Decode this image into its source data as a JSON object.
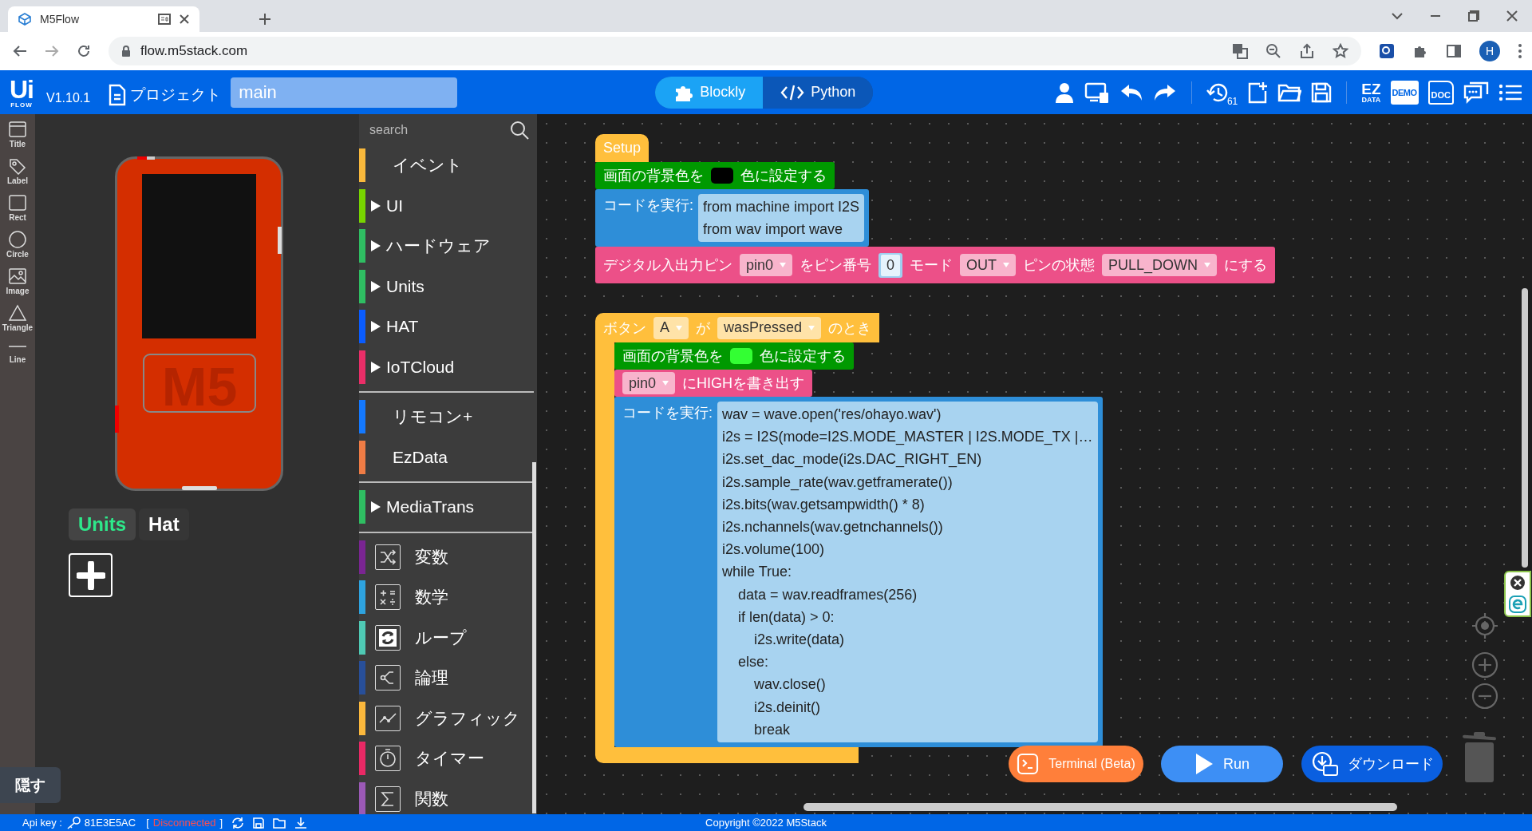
{
  "browser": {
    "tab_title": "M5Flow",
    "url": "flow.m5stack.com",
    "profile_initial": "H"
  },
  "header": {
    "logo": "Ui",
    "logo_sub": "FLOW",
    "version": "V1.10.1",
    "project_label": "プロジェクト",
    "file_name": "main",
    "modes": [
      {
        "label": "Blockly",
        "selected": true
      },
      {
        "label": "Python",
        "selected": false
      }
    ],
    "history_count": "61",
    "ez": "EZ",
    "ez_sub": "DATA",
    "demo": "DEMO",
    "doc": "DOC"
  },
  "tools": [
    "Title",
    "Label",
    "Rect",
    "Circle",
    "Image",
    "Triangle",
    "Line"
  ],
  "device": {
    "logo": "M5",
    "tabs": [
      {
        "label": "Units",
        "selected": true
      },
      {
        "label": "Hat",
        "selected": false
      }
    ]
  },
  "hide_button": "隠す",
  "palette": {
    "placeholder": "search",
    "groups": [
      {
        "items": [
          {
            "label": "イベント",
            "kind": "plain",
            "color": "#f9b93c"
          },
          {
            "label": "UI",
            "kind": "category",
            "color": "#78d400"
          },
          {
            "label": "ハードウェア",
            "kind": "category",
            "color": "#2fbe62"
          },
          {
            "label": "Units",
            "kind": "category",
            "color": "#2fbe62"
          },
          {
            "label": "HAT",
            "kind": "category",
            "color": "#0a5cff"
          },
          {
            "label": "IoTCloud",
            "kind": "category",
            "color": "#ea2e68"
          }
        ]
      },
      {
        "items": [
          {
            "label": "リモコン+",
            "kind": "plain",
            "color": "#1479ff"
          },
          {
            "label": "EzData",
            "kind": "plain",
            "color": "#ef7c45"
          }
        ]
      },
      {
        "items": [
          {
            "label": "MediaTrans",
            "kind": "category",
            "color": "#2fbe62"
          }
        ]
      },
      {
        "items": [
          {
            "label": "変数",
            "kind": "builtin",
            "color": "#7a2592"
          },
          {
            "label": "数学",
            "kind": "builtin",
            "color": "#2ea3df"
          },
          {
            "label": "ループ",
            "kind": "builtin",
            "color": "#4fc9b4"
          },
          {
            "label": "論理",
            "kind": "builtin",
            "color": "#284f99"
          },
          {
            "label": "グラフィック",
            "kind": "builtin",
            "color": "#fbb83c"
          },
          {
            "label": "タイマー",
            "kind": "builtin",
            "color": "#e92965"
          },
          {
            "label": "関数",
            "kind": "builtin",
            "color": "#9b59b6"
          }
        ]
      }
    ]
  },
  "stacks": [
    {
      "blocks": [
        {
          "kind": "hat",
          "color": "#ffbf3c",
          "parts": [
            {
              "kind": "text",
              "text": "Setup"
            }
          ]
        },
        {
          "kind": "statement",
          "color": "#009900",
          "parts": [
            {
              "kind": "text",
              "text": "画面の背景色を"
            },
            {
              "kind": "color",
              "color": "#000000"
            },
            {
              "kind": "text",
              "text": "色に設定する"
            }
          ]
        },
        {
          "kind": "code",
          "color": "#2e8ed8",
          "label": "コードを実行:",
          "lines": [
            "from machine import I2S",
            "from wav import wave"
          ]
        },
        {
          "kind": "statement",
          "color": "#ec5088",
          "parts": [
            {
              "kind": "text",
              "text": "デジタル入出力ピン"
            },
            {
              "kind": "dropdown",
              "text": "pin0"
            },
            {
              "kind": "text",
              "text": "をピン番号"
            },
            {
              "kind": "number",
              "text": "0"
            },
            {
              "kind": "text",
              "text": "モード"
            },
            {
              "kind": "dropdown",
              "text": "OUT"
            },
            {
              "kind": "text",
              "text": "ピンの状態"
            },
            {
              "kind": "dropdown",
              "text": "PULL_DOWN"
            },
            {
              "kind": "text",
              "text": "にする"
            }
          ]
        }
      ]
    },
    {
      "blocks": [
        {
          "kind": "event",
          "color": "#ffbf3c",
          "parts": [
            {
              "kind": "text",
              "text": "ボタン"
            },
            {
              "kind": "dropdown",
              "text": "A"
            },
            {
              "kind": "text",
              "text": "が"
            },
            {
              "kind": "dropdown",
              "text": "wasPressed"
            },
            {
              "kind": "text",
              "text": "のとき"
            }
          ],
          "children": [
            {
              "kind": "statement",
              "color": "#009900",
              "parts": [
                {
                  "kind": "text",
                  "text": "画面の背景色を"
                },
                {
                  "kind": "color",
                  "color": "#33ff33"
                },
                {
                  "kind": "text",
                  "text": "色に設定する"
                }
              ]
            },
            {
              "kind": "statement",
              "color": "#ec5088",
              "parts": [
                {
                  "kind": "dropdown",
                  "text": "pin0"
                },
                {
                  "kind": "text",
                  "text": "にHIGHを書き出す"
                }
              ]
            },
            {
              "kind": "code",
              "color": "#2e8ed8",
              "label": "コードを実行:",
              "lines": [
                "wav = wave.open('res/ohayo.wav')",
                "i2s = I2S(mode=I2S.MODE_MASTER | I2S.MODE_TX |…",
                "i2s.set_dac_mode(i2s.DAC_RIGHT_EN)",
                "i2s.sample_rate(wav.getframerate())",
                "i2s.bits(wav.getsampwidth() * 8)",
                "i2s.nchannels(wav.getnchannels())",
                "i2s.volume(100)",
                "while True:",
                "    data = wav.readframes(256)",
                "    if len(data) > 0:",
                "        i2s.write(data)",
                "    else:",
                "        wav.close()",
                "        i2s.deinit()",
                "        break"
              ]
            }
          ]
        }
      ]
    }
  ],
  "actions": [
    {
      "kind": "terminal",
      "label": "Terminal (Beta)"
    },
    {
      "kind": "run",
      "label": "Run"
    },
    {
      "kind": "download",
      "label": "ダウンロード"
    }
  ],
  "status_bar": {
    "api_key_label": "Api key :",
    "api_key": "81E3E5AC",
    "bracket_open": "[",
    "connection": "Disconnected",
    "bracket_close": "]",
    "copyright": "Copyright ©2022 M5Stack"
  }
}
